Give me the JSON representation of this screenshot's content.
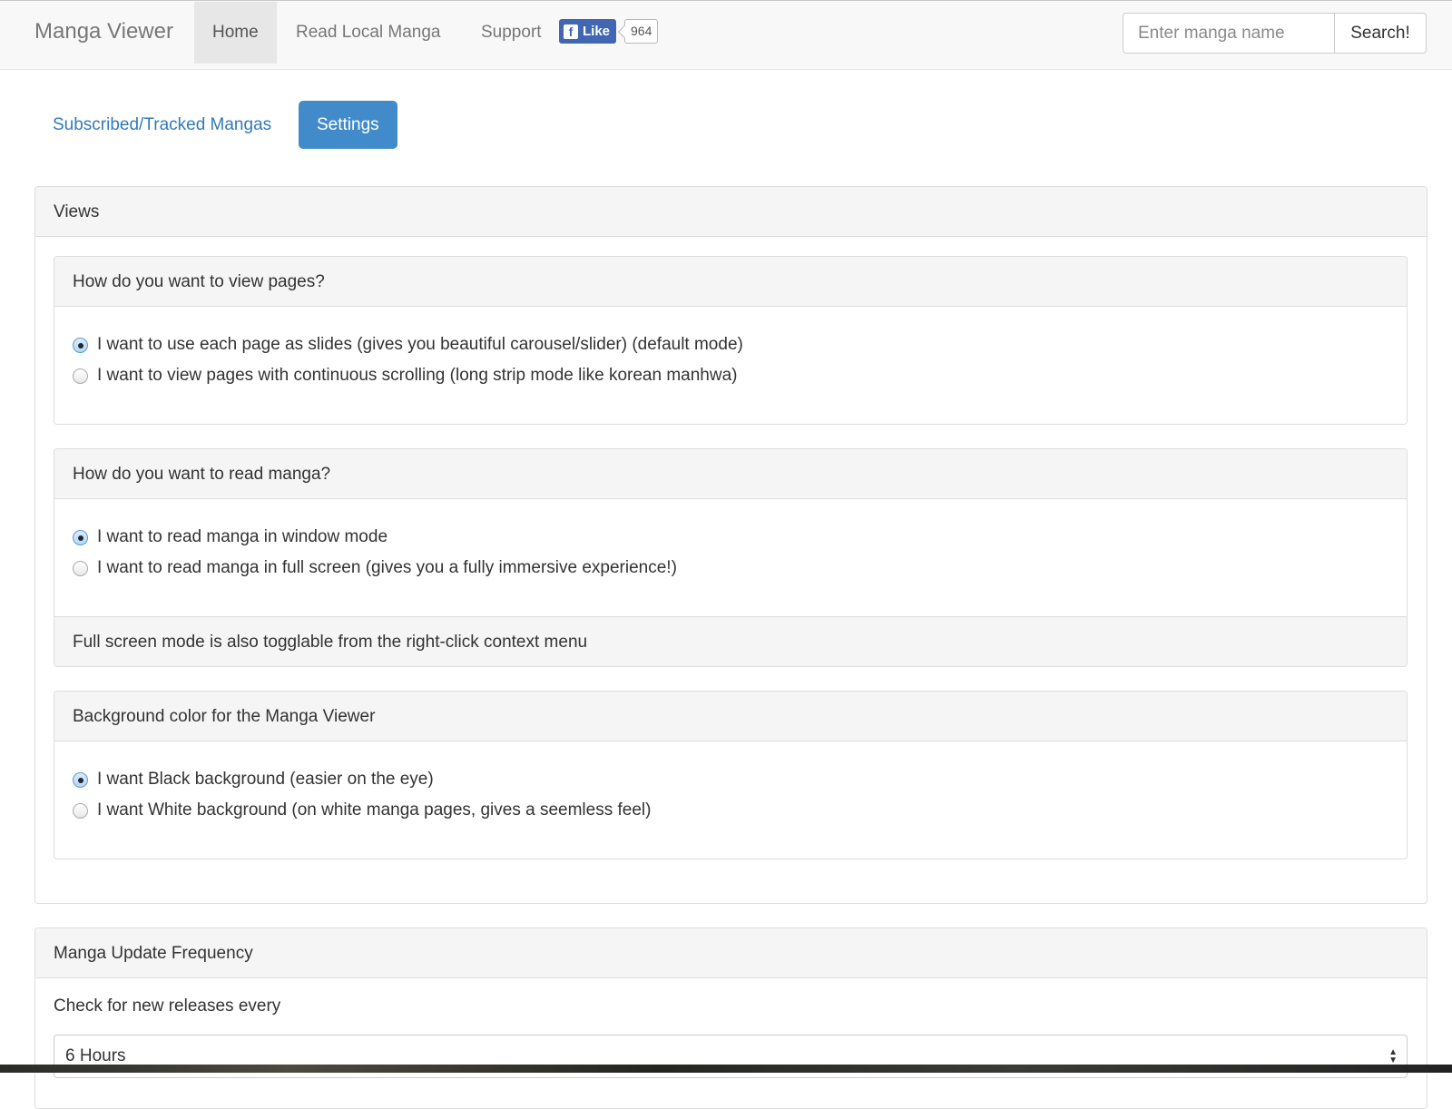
{
  "navbar": {
    "brand": "Manga Viewer",
    "items": [
      {
        "label": "Home",
        "active": true
      },
      {
        "label": "Read Local Manga",
        "active": false
      },
      {
        "label": "Support",
        "active": false
      }
    ],
    "fb_like": {
      "label": "Like",
      "count": "964",
      "icon": "facebook-icon"
    },
    "search": {
      "placeholder": "Enter manga name",
      "button": "Search!"
    }
  },
  "pills": [
    {
      "label": "Subscribed/Tracked Mangas",
      "active": false
    },
    {
      "label": "Settings",
      "active": true
    }
  ],
  "views_panel": {
    "heading": "Views",
    "sections": [
      {
        "heading": "How do you want to view pages?",
        "options": [
          {
            "label": "I want to use each page as slides (gives you beautiful carousel/slider) (default mode)",
            "checked": true
          },
          {
            "label": "I want to view pages with continuous scrolling (long strip mode like korean manhwa)",
            "checked": false
          }
        ]
      },
      {
        "heading": "How do you want to read manga?",
        "options": [
          {
            "label": "I want to read manga in window mode",
            "checked": true
          },
          {
            "label": "I want to read manga in full screen (gives you a fully immersive experience!)",
            "checked": false
          }
        ],
        "footer": "Full screen mode is also togglable from the right-click context menu"
      },
      {
        "heading": "Background color for the Manga Viewer",
        "options": [
          {
            "label": "I want Black background (easier on the eye)",
            "checked": true
          },
          {
            "label": "I want White background (on white manga pages, gives a seemless feel)",
            "checked": false
          }
        ]
      }
    ]
  },
  "update_panel": {
    "heading": "Manga Update Frequency",
    "label": "Check for new releases every",
    "selected": "6 Hours"
  },
  "colors": {
    "accent": "#428bca",
    "link": "#337ab7",
    "fb": "#4267b2"
  }
}
